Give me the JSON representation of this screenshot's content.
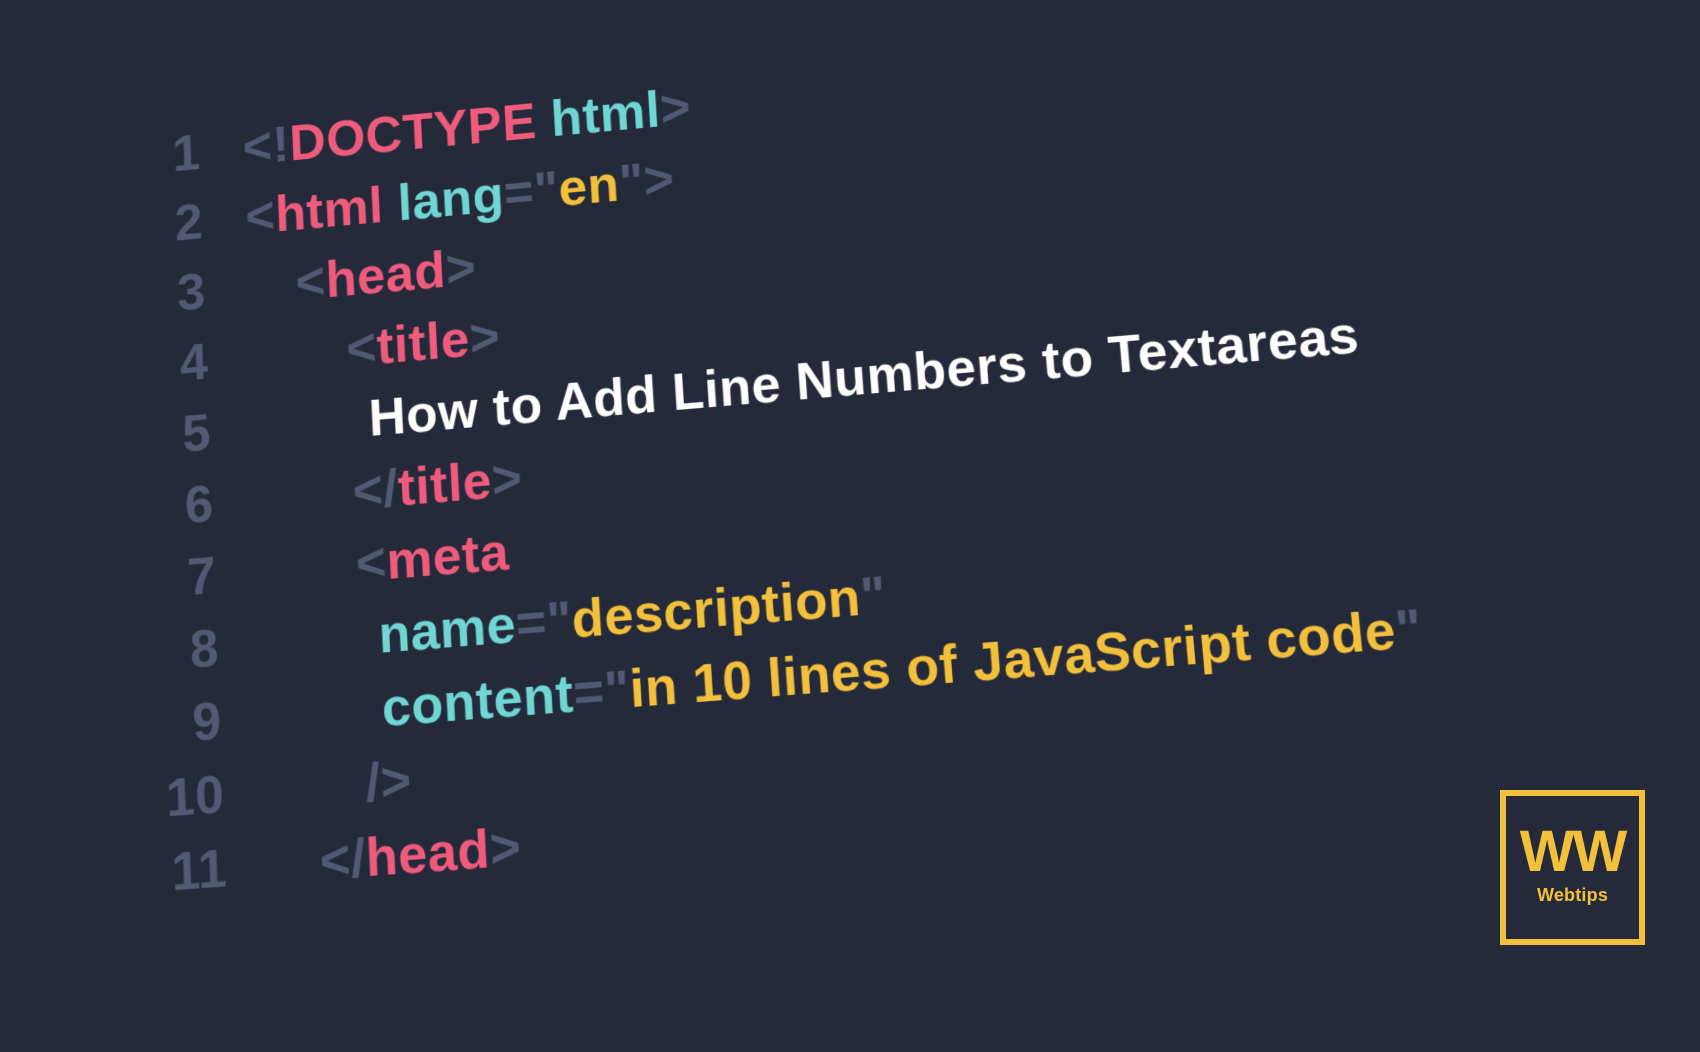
{
  "code": {
    "lines": [
      {
        "num": "1",
        "indent": "",
        "tokens": [
          {
            "t": "punct",
            "v": "<!"
          },
          {
            "t": "tag",
            "v": "DOCTYPE"
          },
          {
            "t": "punct",
            "v": " "
          },
          {
            "t": "attr",
            "v": "html"
          },
          {
            "t": "punct",
            "v": ">"
          }
        ]
      },
      {
        "num": "2",
        "indent": "",
        "tokens": [
          {
            "t": "punct",
            "v": "<"
          },
          {
            "t": "tag",
            "v": "html"
          },
          {
            "t": "punct",
            "v": " "
          },
          {
            "t": "attr",
            "v": "lang"
          },
          {
            "t": "punct",
            "v": "=\""
          },
          {
            "t": "val",
            "v": "en"
          },
          {
            "t": "punct",
            "v": "\">"
          }
        ]
      },
      {
        "num": "3",
        "indent": "ind1",
        "tokens": [
          {
            "t": "punct",
            "v": "<"
          },
          {
            "t": "tag",
            "v": "head"
          },
          {
            "t": "punct",
            "v": ">"
          }
        ]
      },
      {
        "num": "4",
        "indent": "ind2",
        "tokens": [
          {
            "t": "punct",
            "v": "<"
          },
          {
            "t": "tag",
            "v": "title"
          },
          {
            "t": "punct",
            "v": ">"
          }
        ]
      },
      {
        "num": "5",
        "indent": "ind3",
        "tokens": [
          {
            "t": "text",
            "v": "How to Add Line Numbers to Textareas"
          }
        ]
      },
      {
        "num": "6",
        "indent": "ind2",
        "tokens": [
          {
            "t": "punct",
            "v": "</"
          },
          {
            "t": "tag",
            "v": "title"
          },
          {
            "t": "punct",
            "v": ">"
          }
        ]
      },
      {
        "num": "7",
        "indent": "ind2",
        "tokens": [
          {
            "t": "punct",
            "v": "<"
          },
          {
            "t": "tag",
            "v": "meta"
          }
        ]
      },
      {
        "num": "8",
        "indent": "ind3",
        "tokens": [
          {
            "t": "attr",
            "v": "name"
          },
          {
            "t": "punct",
            "v": "=\""
          },
          {
            "t": "val",
            "v": "description"
          },
          {
            "t": "punct",
            "v": "\""
          }
        ]
      },
      {
        "num": "9",
        "indent": "ind3",
        "tokens": [
          {
            "t": "attr",
            "v": "content"
          },
          {
            "t": "punct",
            "v": "=\""
          },
          {
            "t": "val",
            "v": "in 10 lines of JavaScript code"
          },
          {
            "t": "punct",
            "v": "\""
          }
        ]
      },
      {
        "num": "10",
        "indent": "ind2",
        "tokens": [
          {
            "t": "punct",
            "v": "/>"
          }
        ]
      },
      {
        "num": "11",
        "indent": "ind1",
        "tokens": [
          {
            "t": "punct",
            "v": "</"
          },
          {
            "t": "tag",
            "v": "head"
          },
          {
            "t": "punct",
            "v": ">"
          }
        ]
      }
    ]
  },
  "logo": {
    "mark": "WW",
    "label": "Webtips"
  }
}
